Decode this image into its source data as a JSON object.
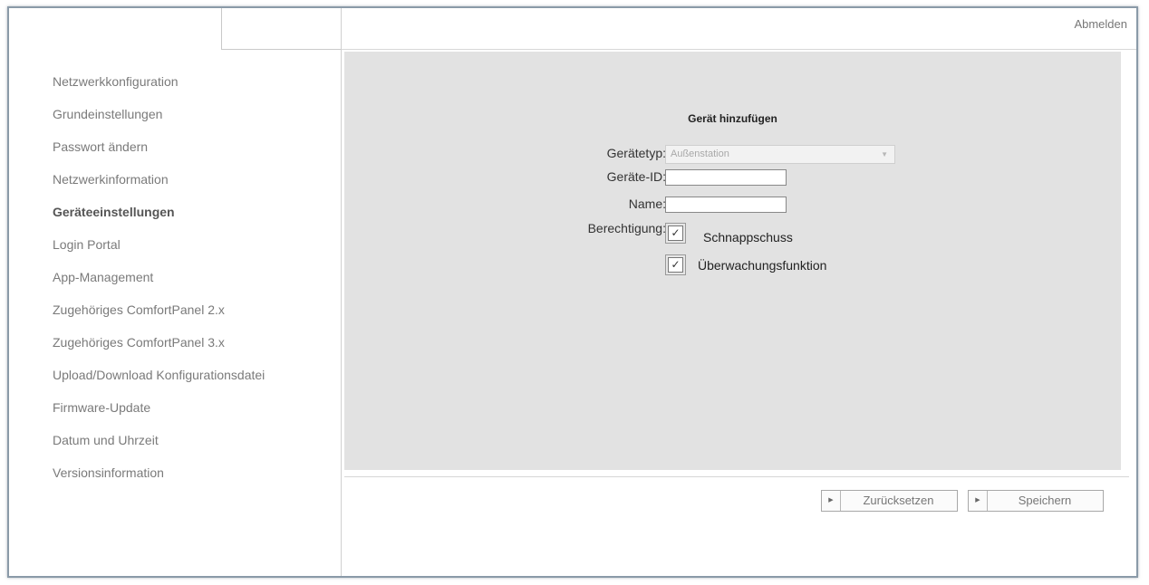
{
  "header": {
    "logout_label": "Abmelden"
  },
  "sidebar": {
    "items": [
      {
        "label": "Netzwerkkonfiguration"
      },
      {
        "label": "Grundeinstellungen"
      },
      {
        "label": "Passwort ändern"
      },
      {
        "label": "Netzwerkinformation"
      },
      {
        "label": "Geräteeinstellungen",
        "active": true
      },
      {
        "label": "Login Portal"
      },
      {
        "label": "App-Management"
      },
      {
        "label": "Zugehöriges ComfortPanel 2.x"
      },
      {
        "label": "Zugehöriges ComfortPanel 3.x"
      },
      {
        "label": "Upload/Download Konfigurationsdatei"
      },
      {
        "label": "Firmware-Update"
      },
      {
        "label": "Datum und Uhrzeit"
      },
      {
        "label": "Versionsinformation"
      }
    ]
  },
  "form": {
    "title": "Gerät hinzufügen",
    "device_type": {
      "label": "Gerätetyp:",
      "value": "Außenstation"
    },
    "device_id": {
      "label": "Geräte-ID:",
      "value": ""
    },
    "name": {
      "label": "Name:",
      "value": ""
    },
    "permission": {
      "label": "Berechtigung:",
      "options": [
        {
          "label": "Schnappschuss",
          "checked": true
        },
        {
          "label": "Überwachungsfunktion",
          "checked": true
        }
      ]
    }
  },
  "actions": {
    "reset_label": "Zurücksetzen",
    "save_label": "Speichern"
  },
  "icons": {
    "check_glyph": "✓",
    "play_glyph": "▶",
    "dropdown_glyph": "▼"
  }
}
